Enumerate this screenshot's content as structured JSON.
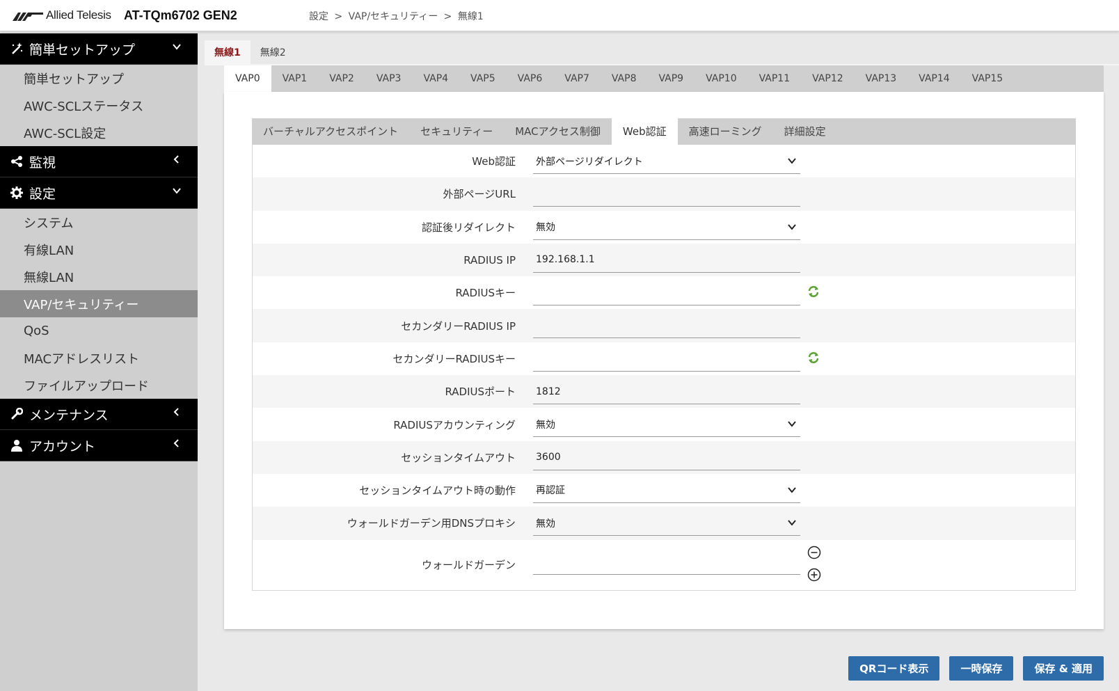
{
  "header": {
    "logo_text": "Allied Telesis",
    "model": "AT-TQm6702 GEN2",
    "breadcrumb": [
      "設定",
      ">",
      "VAP/セキュリティー",
      ">",
      "無線1"
    ]
  },
  "sidebar": {
    "sections": [
      {
        "label": "簡単セットアップ",
        "icon": "wand-icon",
        "expanded": true,
        "items": [
          {
            "label": "簡単セットアップ"
          },
          {
            "label": "AWC-SCLステータス"
          },
          {
            "label": "AWC-SCL設定"
          }
        ]
      },
      {
        "label": "監視",
        "icon": "share-icon",
        "expanded": false,
        "items": []
      },
      {
        "label": "設定",
        "icon": "gear-icon",
        "expanded": true,
        "items": [
          {
            "label": "システム"
          },
          {
            "label": "有線LAN"
          },
          {
            "label": "無線LAN"
          },
          {
            "label": "VAP/セキュリティー",
            "active": true
          },
          {
            "label": "QoS"
          },
          {
            "label": "MACアドレスリスト"
          },
          {
            "label": "ファイルアップロード"
          }
        ]
      },
      {
        "label": "メンテナンス",
        "icon": "wrench-icon",
        "expanded": false,
        "items": []
      },
      {
        "label": "アカウント",
        "icon": "user-icon",
        "expanded": false,
        "items": []
      }
    ]
  },
  "radio_tabs": [
    "無線1",
    "無線2"
  ],
  "vap_tabs": [
    "VAP0",
    "VAP1",
    "VAP2",
    "VAP3",
    "VAP4",
    "VAP5",
    "VAP6",
    "VAP7",
    "VAP8",
    "VAP9",
    "VAP10",
    "VAP11",
    "VAP12",
    "VAP13",
    "VAP14",
    "VAP15"
  ],
  "section_tabs": [
    "バーチャルアクセスポイント",
    "セキュリティー",
    "MACアクセス制御",
    "Web認証",
    "高速ローミング",
    "詳細設定"
  ],
  "form": {
    "rows": [
      {
        "label": "Web認証",
        "type": "select",
        "value": "外部ページリダイレクト"
      },
      {
        "label": "外部ページURL",
        "type": "text",
        "value": ""
      },
      {
        "label": "認証後リダイレクト",
        "type": "select",
        "value": "無効"
      },
      {
        "label": "RADIUS IP",
        "type": "text",
        "value": "192.168.1.1"
      },
      {
        "label": "RADIUSキー",
        "type": "text",
        "value": "",
        "icon": "refresh-icon"
      },
      {
        "label": "セカンダリーRADIUS IP",
        "type": "text",
        "value": ""
      },
      {
        "label": "セカンダリーRADIUSキー",
        "type": "text",
        "value": "",
        "icon": "refresh-icon"
      },
      {
        "label": "RADIUSポート",
        "type": "text",
        "value": "1812"
      },
      {
        "label": "RADIUSアカウンティング",
        "type": "select",
        "value": "無効"
      },
      {
        "label": "セッションタイムアウト",
        "type": "text",
        "value": "3600"
      },
      {
        "label": "セッションタイムアウト時の動作",
        "type": "select",
        "value": "再認証"
      },
      {
        "label": "ウォールドガーデン用DNSプロキシ",
        "type": "select",
        "value": "無効"
      },
      {
        "label": "ウォールドガーデン",
        "type": "text",
        "value": ""
      }
    ]
  },
  "buttons": {
    "qr": "QRコード表示",
    "temp_save": "一時保存",
    "save_apply": "保存 & 適用"
  },
  "colors": {
    "accent_button": "#2d6ca8",
    "active_tab_text": "#8a1b1b",
    "sidebar_bg": "#cfcfcf",
    "sidebar_section_bg": "#000000",
    "sidebar_active_bg": "#8c8c8c",
    "refresh_icon": "#5aa332"
  }
}
